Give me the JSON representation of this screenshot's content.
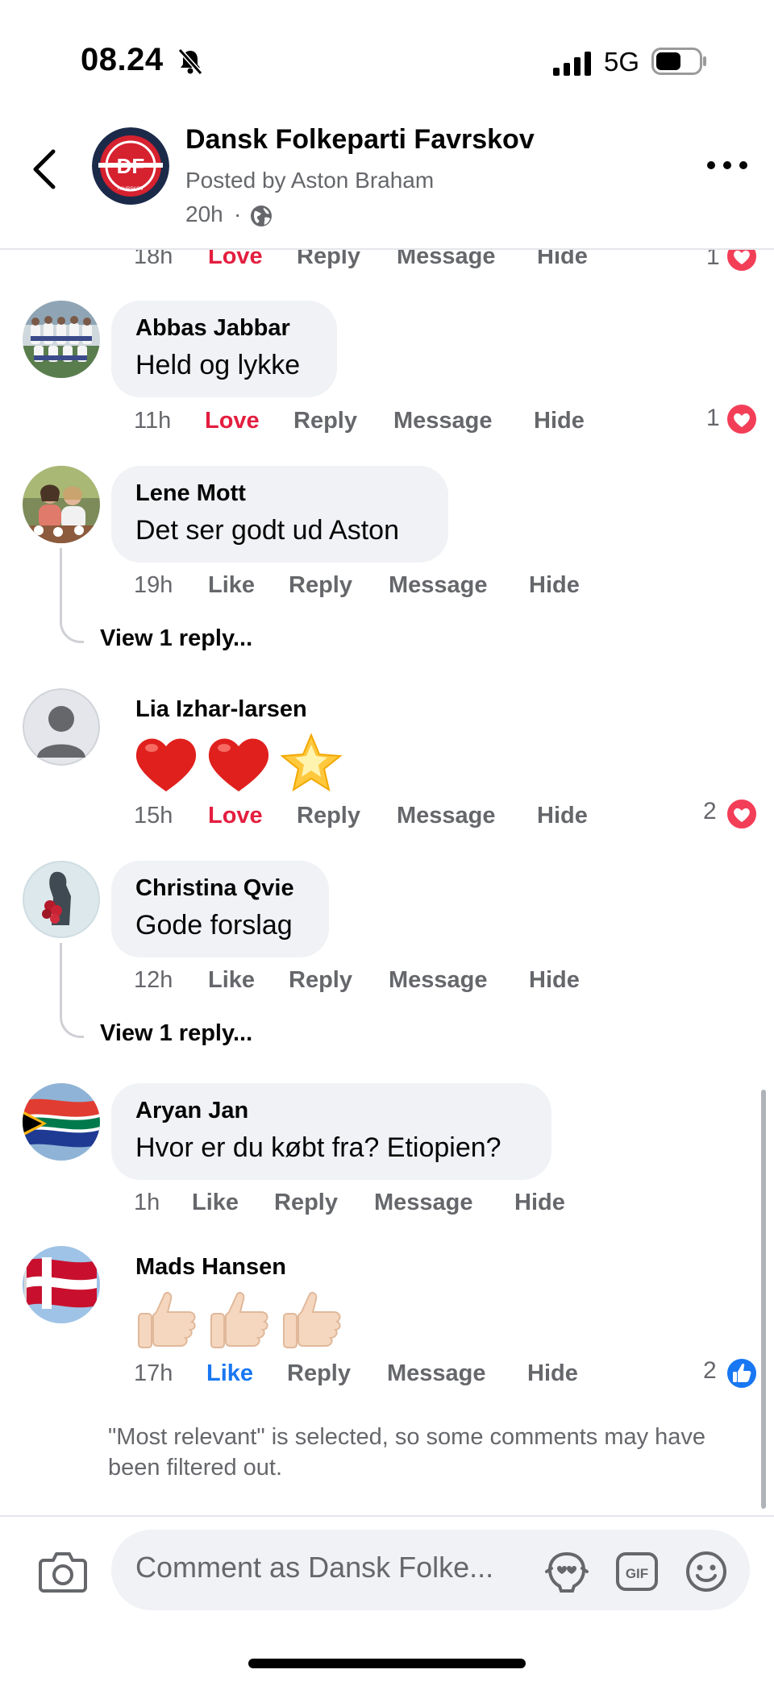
{
  "status_bar": {
    "time": "08.24",
    "network": "5G"
  },
  "header": {
    "page_name": "Dansk Folkeparti Favrskov",
    "posted_by": "Posted by Aston Braham",
    "time": "20h",
    "separator": "·",
    "avatar_text": "DF",
    "avatar_subtext": "FAVRSKOV"
  },
  "actions": {
    "like": "Like",
    "love": "Love",
    "reply": "Reply",
    "message": "Message",
    "hide": "Hide",
    "view_reply": "View 1 reply..."
  },
  "top_partial": {
    "time": "18h",
    "reaction_label": "Love",
    "reaction_count": "1"
  },
  "comments": [
    {
      "author": "Abbas Jabbar",
      "text": "Held og lykke",
      "time": "11h",
      "reaction_label": "Love",
      "reaction_count": "1"
    },
    {
      "author": "Lene Mott",
      "text": "Det ser godt ud Aston",
      "time": "19h",
      "reaction_label": "Like"
    },
    {
      "author": "Lia Izhar-larsen",
      "text": "❤️❤️🌟",
      "time": "15h",
      "reaction_label": "Love",
      "reaction_count": "2"
    },
    {
      "author": "Christina Qvie",
      "text": "Gode forslag",
      "time": "12h",
      "reaction_label": "Like"
    },
    {
      "author": "Aryan Jan",
      "text": "Hvor er du købt fra? Etiopien?",
      "time": "1h",
      "reaction_label": "Like"
    },
    {
      "author": "Mads Hansen",
      "text": "👍🏻👍🏻👍🏻",
      "time": "17h",
      "reaction_label": "Like",
      "reaction_count": "2"
    }
  ],
  "filter_notice": "\"Most relevant\" is selected, so some comments may have been filtered out.",
  "composer": {
    "placeholder": "Comment as Dansk Folke...",
    "gif_label": "GIF"
  },
  "colors": {
    "love": "#e41e3f",
    "like": "#1877f2",
    "secondary_text": "#65676b",
    "bubble": "#f0f2f5",
    "df_red": "#d6212f",
    "df_navy": "#1c2a4a"
  }
}
